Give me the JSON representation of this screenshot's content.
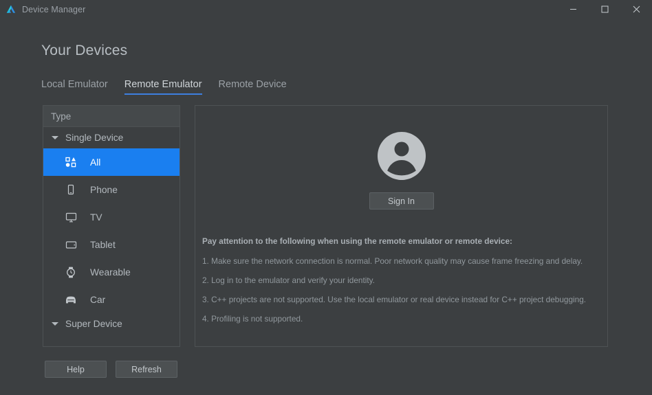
{
  "window": {
    "title": "Device Manager",
    "logo_icon": "deveco-logo-icon",
    "controls": {
      "minimize": "minimize-icon",
      "maximize": "maximize-icon",
      "close": "close-icon"
    }
  },
  "page": {
    "heading": "Your Devices"
  },
  "tabs": [
    {
      "label": "Local Emulator",
      "active": false
    },
    {
      "label": "Remote Emulator",
      "active": true
    },
    {
      "label": "Remote Device",
      "active": false
    }
  ],
  "sidebar": {
    "header": "Type",
    "groups": [
      {
        "label": "Single Device",
        "expanded": true,
        "items": [
          {
            "label": "All",
            "icon": "shapes-grid-icon",
            "selected": true
          },
          {
            "label": "Phone",
            "icon": "phone-icon",
            "selected": false
          },
          {
            "label": "TV",
            "icon": "tv-icon",
            "selected": false
          },
          {
            "label": "Tablet",
            "icon": "tablet-icon",
            "selected": false
          },
          {
            "label": "Wearable",
            "icon": "watch-icon",
            "selected": false
          },
          {
            "label": "Car",
            "icon": "car-icon",
            "selected": false
          }
        ]
      },
      {
        "label": "Super Device",
        "expanded": true,
        "items": []
      }
    ]
  },
  "content": {
    "avatar_icon": "user-avatar-icon",
    "sign_in_label": "Sign In",
    "notice_title": "Pay attention to the following when using the remote emulator or remote device:",
    "notice_items": [
      "1. Make sure the network connection is normal. Poor network quality may cause frame freezing and delay.",
      "2. Log in to the emulator and verify your identity.",
      "3. C++ projects are not supported. Use the local emulator or real device instead for C++ project debugging.",
      "4. Profiling is not supported."
    ]
  },
  "footer": {
    "help_label": "Help",
    "refresh_label": "Refresh"
  },
  "colors": {
    "background": "#3c3f41",
    "panel_border": "#4e5254",
    "selection_blue": "#1a7ff0",
    "tab_underline": "#3d7fe0",
    "text_primary": "#b3b9be",
    "text_muted": "#91989d"
  }
}
